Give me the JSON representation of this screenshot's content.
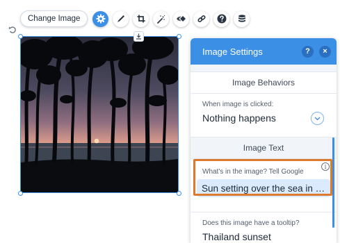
{
  "toolbar": {
    "change_image_label": "Change Image",
    "tools": [
      "settings-icon",
      "pen-icon",
      "crop-icon",
      "magic-wand-icon",
      "animation-icon",
      "link-icon",
      "help-icon",
      "layers-icon"
    ]
  },
  "panel": {
    "title": "Image Settings",
    "help_label": "?",
    "close_label": "×",
    "behaviors_section": "Image Behaviors",
    "click_label": "When image is clicked:",
    "click_value": "Nothing happens",
    "image_text_section": "Image Text",
    "alt_label": "What's in the image? Tell Google",
    "alt_value": "Sun setting over the sea in …",
    "info_label": "i",
    "tooltip_label": "Does this image have a tooltip?",
    "tooltip_value": "Thailand sunset"
  },
  "colors": {
    "accent": "#3b8fe5",
    "highlight": "#dd7a2e"
  }
}
